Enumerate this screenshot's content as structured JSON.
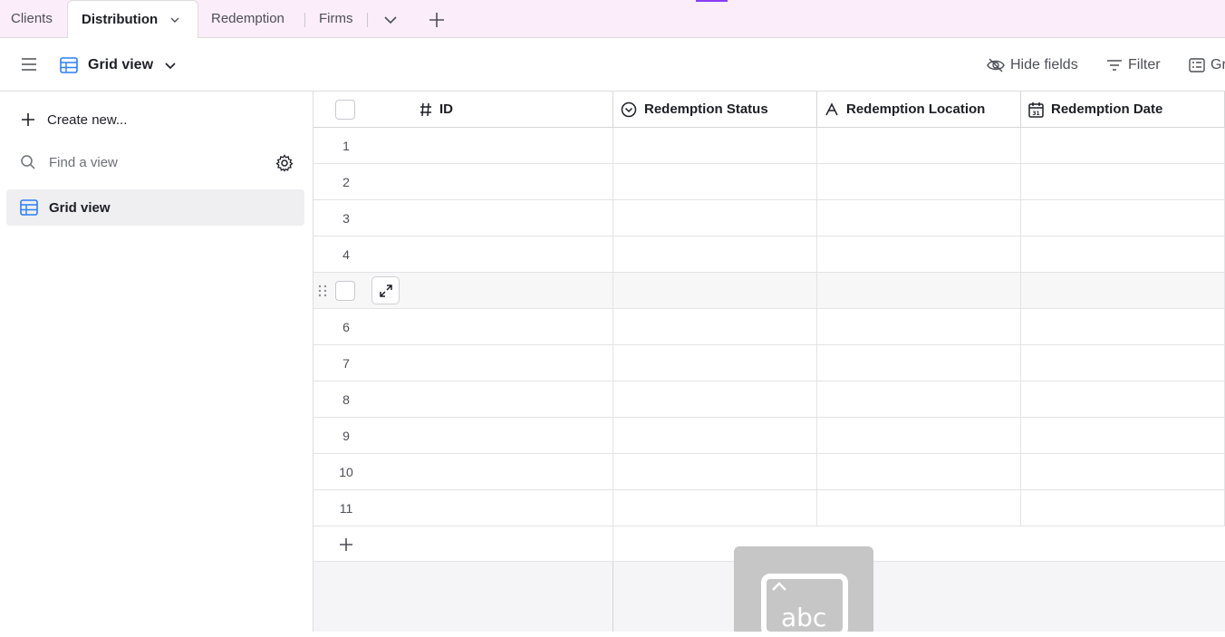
{
  "tabs": {
    "clients": "Clients",
    "distribution": "Distribution",
    "redemption": "Redemption",
    "firms": "Firms"
  },
  "toolbar": {
    "view_name": "Grid view",
    "hide_fields": "Hide fields",
    "filter": "Filter",
    "group": "Gr"
  },
  "sidebar": {
    "create_new": "Create new...",
    "find_placeholder": "Find a view",
    "items": [
      {
        "label": "Grid view",
        "icon": "grid-icon"
      }
    ]
  },
  "grid": {
    "columns": [
      {
        "label": "ID",
        "icon": "hash-icon"
      },
      {
        "label": "Redemption Status",
        "icon": "single-select-icon"
      },
      {
        "label": "Redemption Location",
        "icon": "text-field-icon"
      },
      {
        "label": "Redemption Date",
        "icon": "calendar-icon"
      }
    ],
    "rows": [
      "1",
      "2",
      "3",
      "4",
      "",
      "6",
      "7",
      "8",
      "9",
      "10",
      "11"
    ]
  },
  "keyboard_overlay": {
    "label": "abc"
  },
  "colors": {
    "accent": "#8b3cf0",
    "tabbar": "#fbedfa",
    "grid_icon": "#2d7ff9"
  }
}
